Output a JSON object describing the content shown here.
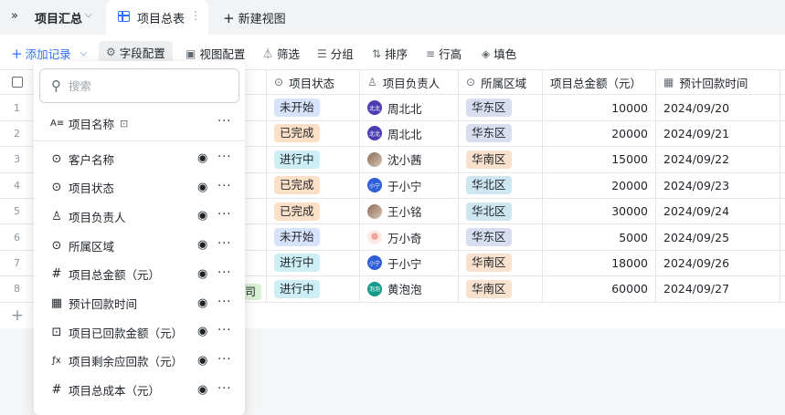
{
  "topbar": {
    "expand_icon": "»",
    "table_name": "项目汇总",
    "tab_active": "项目总表",
    "tab_more": "⋮",
    "new_view": "新建视图"
  },
  "toolbar": {
    "add_record": "添加记录",
    "field_config": "字段配置",
    "view_config": "视图配置",
    "filter": "筛选",
    "group": "分组",
    "sort": "排序",
    "row_height": "行高",
    "fill_color": "填色"
  },
  "table": {
    "headers": {
      "status": "项目状态",
      "owner": "项目负责人",
      "region": "所属区域",
      "amount": "项目总金额（元）",
      "date": "预计回款时间"
    },
    "rows": [
      {
        "idx": "1",
        "status": "未开始",
        "owner": "周北北",
        "owner_avatar": "北北",
        "region": "华东区",
        "amount": "10000",
        "date": "2024/09/20"
      },
      {
        "idx": "2",
        "status": "已完成",
        "owner": "周北北",
        "owner_avatar": "北北",
        "region": "华东区",
        "amount": "20000",
        "date": "2024/09/21"
      },
      {
        "idx": "3",
        "status": "进行中",
        "owner": "沈小茜",
        "owner_avatar": "",
        "region": "华南区",
        "amount": "15000",
        "date": "2024/09/22"
      },
      {
        "idx": "4",
        "status": "已完成",
        "owner": "于小宁",
        "owner_avatar": "小宁",
        "region": "华北区",
        "amount": "20000",
        "date": "2024/09/23"
      },
      {
        "idx": "5",
        "status": "已完成",
        "owner": "王小铭",
        "owner_avatar": "",
        "region": "华北区",
        "amount": "30000",
        "date": "2024/09/24"
      },
      {
        "idx": "6",
        "status": "未开始",
        "owner": "万小奇",
        "owner_avatar": "",
        "region": "华东区",
        "amount": "5000",
        "date": "2024/09/25"
      },
      {
        "idx": "7",
        "status": "进行中",
        "owner": "于小宁",
        "owner_avatar": "小宁",
        "region": "华南区",
        "amount": "18000",
        "date": "2024/09/26"
      },
      {
        "idx": "8",
        "status": "进行中",
        "owner": "黄泡泡",
        "owner_avatar": "泡泡",
        "region": "华南区",
        "amount": "60000",
        "date": "2024/09/27"
      }
    ],
    "company_fragment": "司",
    "add_row": "+"
  },
  "status_colors": {
    "未开始": "#d7e3fb",
    "已完成": "#fbdfc6",
    "进行中": "#cdeef5"
  },
  "region_colors": {
    "华东区": "#d8def0",
    "华南区": "#f8e1cd",
    "华北区": "#cde6f0"
  },
  "panel": {
    "search_placeholder": "搜索",
    "fields": [
      {
        "label": "项目名称",
        "icon": "text-icon",
        "locked": true
      },
      {
        "label": "客户名称",
        "icon": "select-icon"
      },
      {
        "label": "项目状态",
        "icon": "select-icon"
      },
      {
        "label": "项目负责人",
        "icon": "person-icon"
      },
      {
        "label": "所属区域",
        "icon": "select-icon"
      },
      {
        "label": "项目总金额（元）",
        "icon": "number-icon"
      },
      {
        "label": "预计回款时间",
        "icon": "date-icon"
      },
      {
        "label": "项目已回款金额（元）",
        "icon": "lookup-icon"
      },
      {
        "label": "项目剩余应回款（元）",
        "icon": "formula-icon"
      },
      {
        "label": "项目总成本（元）",
        "icon": "number-icon"
      }
    ]
  }
}
